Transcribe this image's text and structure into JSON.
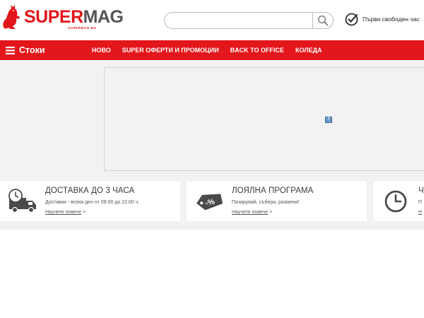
{
  "brand": {
    "logo_main_super": "SUPER",
    "logo_main_mag": "MAG",
    "logo_sub": "SUPERMAG.BG",
    "accent_color": "#e3161b"
  },
  "search": {
    "value": "",
    "placeholder": "",
    "button_icon": "search-icon"
  },
  "header": {
    "free_hour_label": "Първи свободен час",
    "free_hour_icon": "check-circle-icon"
  },
  "nav": {
    "categories_label": "Стоки",
    "categories_icon": "hamburger-icon",
    "links": [
      "НОВО",
      "SUPER ОФЕРТИ И ПРОМОЦИИ",
      "BACK TO OFFICE",
      "Коледа"
    ]
  },
  "cards": [
    {
      "icon": "delivery-truck-clock-icon",
      "title": "ДОСТАВКА ДО 3 ЧАСА",
      "text": "Доставки - всеки ден от 08:00 до 22:00 ч.",
      "link": "Научете повече",
      "link_suffix": " >"
    },
    {
      "icon": "discount-tag-icon",
      "title": "ЛОЯЛНА ПРОГРАМА",
      "text": "Пазарувай, събери, размени!",
      "link": "Научете повече",
      "link_suffix": " >"
    },
    {
      "icon": "clock-icon",
      "title": "Ч",
      "text": "П",
      "link": "Н",
      "link_suffix": ""
    }
  ]
}
